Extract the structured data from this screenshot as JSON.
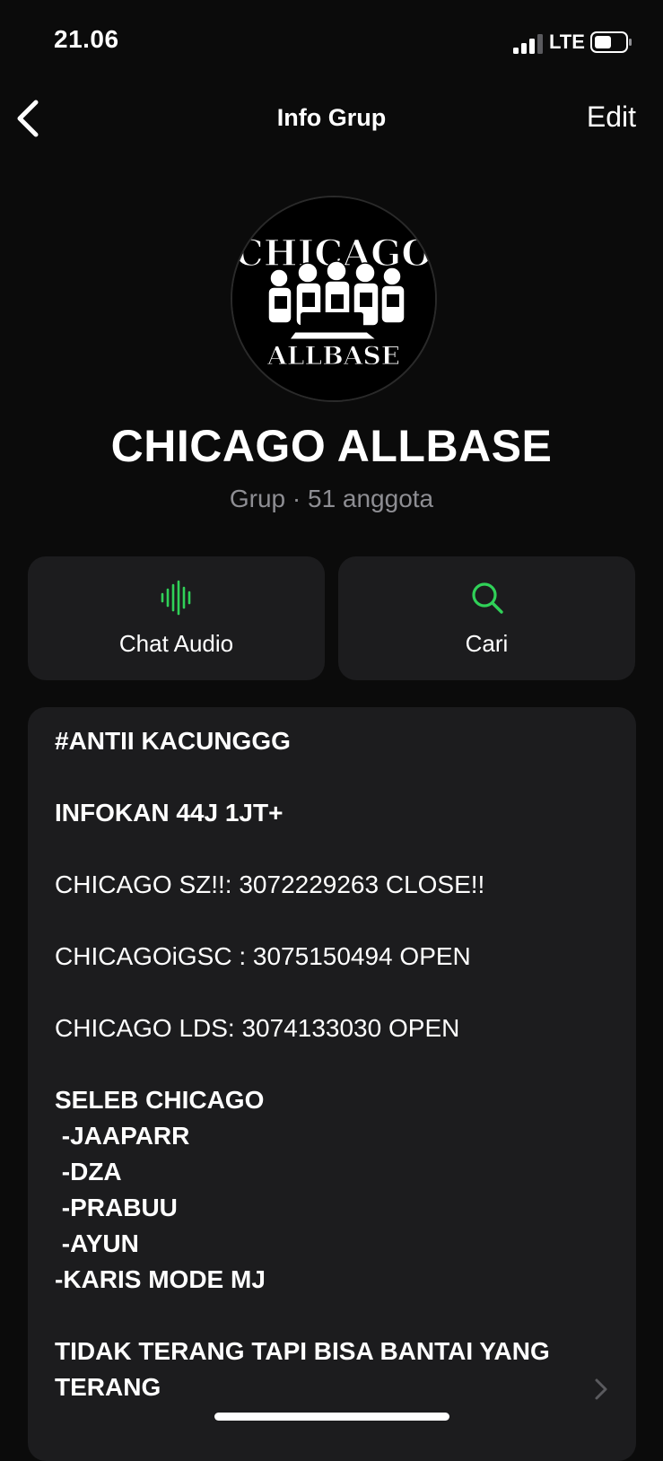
{
  "status_bar": {
    "time": "21.06",
    "network": "LTE"
  },
  "nav": {
    "back_icon": "chevron-left-icon",
    "title": "Info Grup",
    "edit_label": "Edit"
  },
  "group": {
    "avatar_text_top": "CHICAGO",
    "avatar_text_bottom": "ALLBASE",
    "name": "CHICAGO ALLBASE",
    "meta": "Grup · 51 anggota"
  },
  "actions": [
    {
      "label": "Chat Audio",
      "icon": "audio-waveform-icon"
    },
    {
      "label": "Cari",
      "icon": "search-icon"
    }
  ],
  "description": {
    "lines": [
      "#ANTII KACUNGGG",
      "",
      "INFOKAN 44J 1JT+",
      "",
      "CHICAGO SZ!!: 3072229263 CLOSE!!",
      "",
      "CHICAGOiGSC : 3075150494 OPEN",
      "",
      "CHICAGO LDS: 3074133030 OPEN",
      "",
      "SELEB CHICAGO",
      " -JAAPARR",
      " -DZA",
      " -PRABUU",
      " -AYUN",
      "-KARIS MODE MJ",
      "",
      "TIDAK TERANG TAPI BISA BANTAI YANG TERANG"
    ]
  },
  "colors": {
    "background": "#0b0b0b",
    "card": "#1c1c1e",
    "accent_green": "#30d158",
    "secondary_text": "#8e8e93"
  }
}
